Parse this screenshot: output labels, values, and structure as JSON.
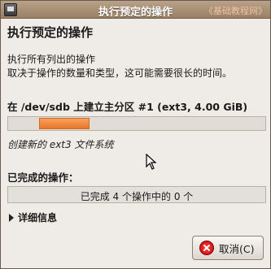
{
  "window": {
    "title": "执行预定的操作",
    "watermark": "《基础教程网》"
  },
  "dialog": {
    "heading": "执行预定的操作",
    "description_line1": "执行所有列出的操作",
    "description_line2": "取决于操作的数量和类型，这可能需要很长的时间。",
    "operation_title": "在 /dev/sdb 上建立主分区 #1 (ext3, 4.00 GiB)",
    "operation_progress": "indeterminate",
    "subtask": "创建新的 ext3 文件系统",
    "completed_label": "已完成的操作：",
    "completed_text": "已完成 4 个操作中的 0 个",
    "completed_fraction": 0,
    "details_label": "详细信息",
    "cancel_label": "取消(C)"
  },
  "colors": {
    "titlebar": "#9a8066",
    "progress_fill": "#e8762a",
    "background": "#efebe7"
  },
  "icons": {
    "app": "terminal-icon",
    "cancel": "cancel-icon",
    "expander": "triangle-right-icon",
    "cursor": "mouse-pointer-icon"
  }
}
